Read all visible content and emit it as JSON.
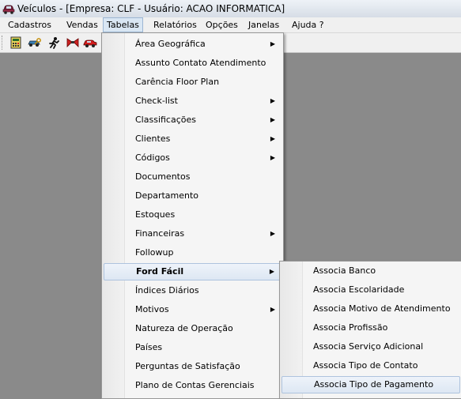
{
  "window": {
    "title": "Veículos - [Empresa: CLF - Usuário: ACAO INFORMATICA]"
  },
  "menubar": {
    "items": [
      {
        "label": "Cadastros"
      },
      {
        "label": "Vendas"
      },
      {
        "label": "Tabelas"
      },
      {
        "label": "Relatórios"
      },
      {
        "label": "Opções"
      },
      {
        "label": "Janelas"
      },
      {
        "label": "Ajuda ?"
      }
    ]
  },
  "toolbar": {
    "icons": [
      "calculator-icon",
      "car-key-icon",
      "runner-icon",
      "bowtie-icon",
      "red-car-icon"
    ]
  },
  "tabelas_menu": {
    "items": [
      {
        "label": "Área Geográfica",
        "submenu": true
      },
      {
        "label": "Assunto Contato Atendimento",
        "submenu": false
      },
      {
        "label": "Carência Floor Plan",
        "submenu": false
      },
      {
        "label": "Check-list",
        "submenu": true
      },
      {
        "label": "Classificações",
        "submenu": true
      },
      {
        "label": "Clientes",
        "submenu": true
      },
      {
        "label": "Códigos",
        "submenu": true
      },
      {
        "label": "Documentos",
        "submenu": false
      },
      {
        "label": "Departamento",
        "submenu": false
      },
      {
        "label": "Estoques",
        "submenu": false
      },
      {
        "label": "Financeiras",
        "submenu": true
      },
      {
        "label": "Followup",
        "submenu": false
      },
      {
        "label": "Ford Fácil",
        "submenu": true
      },
      {
        "label": "Índices Diários",
        "submenu": false
      },
      {
        "label": "Motivos",
        "submenu": true
      },
      {
        "label": "Natureza de Operação",
        "submenu": false
      },
      {
        "label": "Países",
        "submenu": false
      },
      {
        "label": "Perguntas de Satisfação",
        "submenu": false
      },
      {
        "label": "Plano de Contas Gerenciais",
        "submenu": false
      }
    ]
  },
  "ford_facil_menu": {
    "items": [
      {
        "label": "Associa Banco"
      },
      {
        "label": "Associa Escolaridade"
      },
      {
        "label": "Associa Motivo de Atendimento"
      },
      {
        "label": "Associa Profissão"
      },
      {
        "label": "Associa Serviço Adicional"
      },
      {
        "label": "Associa Tipo de Contato"
      },
      {
        "label": "Associa Tipo de Pagamento"
      }
    ]
  },
  "colors": {
    "workspace": "#8a8a8a",
    "menu_bg": "#f5f5f5",
    "highlight": "#dde7f3"
  }
}
